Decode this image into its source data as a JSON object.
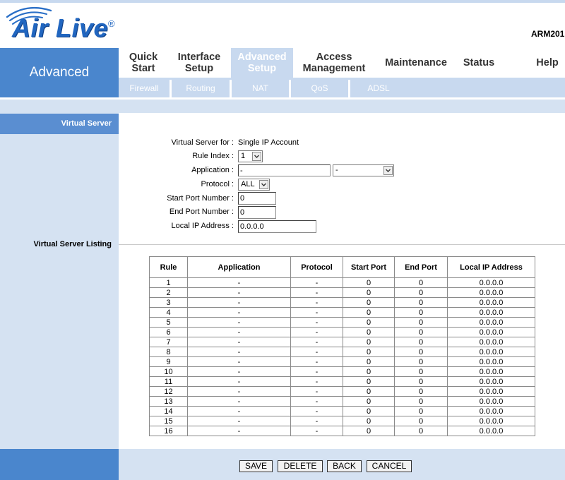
{
  "colors": {
    "nav_blue": "#4a86cd",
    "panel_light": "#d5e2f2",
    "title_blue": "#5a8ed1",
    "subnav_blue": "#c8d9ef",
    "logo_blue": "#2166c0"
  },
  "header": {
    "logo_text": "Air Live",
    "logo_mark": "®",
    "logo_icon": "wireless-swoosh-icon",
    "model": "ARM201"
  },
  "nav": {
    "section": "Advanced",
    "items": [
      {
        "lines": [
          "Quick",
          "Start"
        ]
      },
      {
        "lines": [
          "Interface",
          "Setup"
        ]
      },
      {
        "lines": [
          "Advanced",
          "Setup"
        ]
      },
      {
        "lines": [
          "Access",
          "Management"
        ]
      },
      {
        "lines": [
          "Maintenance"
        ]
      },
      {
        "lines": [
          "Status"
        ]
      },
      {
        "lines": [
          "Help"
        ]
      }
    ],
    "subitems": [
      "Firewall",
      "Routing",
      "NAT",
      "QoS",
      "ADSL"
    ]
  },
  "sidebar": {
    "title": "Virtual Server",
    "listing_title": "Virtual Server Listing"
  },
  "form": {
    "virtual_server_for": {
      "label": "Virtual Server for :",
      "value": "Single IP Account"
    },
    "rule_index": {
      "label": "Rule Index :",
      "value": "1"
    },
    "application": {
      "label": "Application :",
      "value": "-",
      "preset": "-"
    },
    "protocol": {
      "label": "Protocol :",
      "value": "ALL"
    },
    "start_port": {
      "label": "Start Port Number :",
      "value": "0"
    },
    "end_port": {
      "label": "End Port Number :",
      "value": "0"
    },
    "local_ip": {
      "label": "Local IP Address :",
      "value": "0.0.0.0"
    }
  },
  "table": {
    "headers": [
      "Rule",
      "Application",
      "Protocol",
      "Start Port",
      "End Port",
      "Local IP Address"
    ],
    "rows": [
      [
        "1",
        "-",
        "-",
        "0",
        "0",
        "0.0.0.0"
      ],
      [
        "2",
        "-",
        "-",
        "0",
        "0",
        "0.0.0.0"
      ],
      [
        "3",
        "-",
        "-",
        "0",
        "0",
        "0.0.0.0"
      ],
      [
        "4",
        "-",
        "-",
        "0",
        "0",
        "0.0.0.0"
      ],
      [
        "5",
        "-",
        "-",
        "0",
        "0",
        "0.0.0.0"
      ],
      [
        "6",
        "-",
        "-",
        "0",
        "0",
        "0.0.0.0"
      ],
      [
        "7",
        "-",
        "-",
        "0",
        "0",
        "0.0.0.0"
      ],
      [
        "8",
        "-",
        "-",
        "0",
        "0",
        "0.0.0.0"
      ],
      [
        "9",
        "-",
        "-",
        "0",
        "0",
        "0.0.0.0"
      ],
      [
        "10",
        "-",
        "-",
        "0",
        "0",
        "0.0.0.0"
      ],
      [
        "11",
        "-",
        "-",
        "0",
        "0",
        "0.0.0.0"
      ],
      [
        "12",
        "-",
        "-",
        "0",
        "0",
        "0.0.0.0"
      ],
      [
        "13",
        "-",
        "-",
        "0",
        "0",
        "0.0.0.0"
      ],
      [
        "14",
        "-",
        "-",
        "0",
        "0",
        "0.0.0.0"
      ],
      [
        "15",
        "-",
        "-",
        "0",
        "0",
        "0.0.0.0"
      ],
      [
        "16",
        "-",
        "-",
        "0",
        "0",
        "0.0.0.0"
      ]
    ]
  },
  "buttons": {
    "save": "SAVE",
    "delete": "DELETE",
    "back": "BACK",
    "cancel": "CANCEL"
  }
}
